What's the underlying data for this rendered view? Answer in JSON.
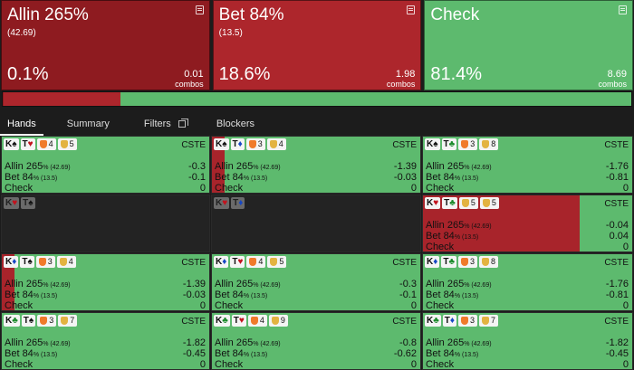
{
  "actions": [
    {
      "name": "Allin 265%",
      "sub": "(42.69)",
      "pct": "0.1%",
      "combos": "0.01",
      "combos_label": "combos",
      "color": "#8e1b20"
    },
    {
      "name": "Bet 84%",
      "sub": "(13.5)",
      "pct": "18.6%",
      "combos": "1.98",
      "combos_label": "combos",
      "color": "#ad262c"
    },
    {
      "name": "Check",
      "sub": "",
      "pct": "81.4%",
      "combos": "8.69",
      "combos_label": "combos",
      "color": "#5dba6e"
    }
  ],
  "freq_bar": [
    {
      "label": "Allin",
      "fraction": 0.001,
      "color": "#8e1b20"
    },
    {
      "label": "Bet",
      "fraction": 0.186,
      "color": "#ad262c"
    },
    {
      "label": "Check",
      "fraction": 0.814,
      "color": "#5dba6e"
    }
  ],
  "tabs": [
    {
      "label": "Hands",
      "active": true
    },
    {
      "label": "Summary",
      "active": false
    },
    {
      "label": "Filters",
      "active": false
    },
    {
      "label": "Blockers",
      "active": false
    }
  ],
  "cell_tag": "CSTE",
  "row_labels": [
    "Allin 265",
    "Bet 84",
    "Check"
  ],
  "row_subs": [
    "% (42.69)",
    "% (13.5)",
    ""
  ],
  "cells": [
    {
      "cards": [
        [
          "K",
          "s"
        ],
        [
          "T",
          "h"
        ]
      ],
      "badges": [
        [
          "orange",
          "4"
        ],
        [
          "gold",
          "5"
        ]
      ],
      "red": 0.0,
      "values": [
        "-0.3",
        "-0.1",
        "0"
      ]
    },
    {
      "cards": [
        [
          "K",
          "s"
        ],
        [
          "T",
          "d"
        ]
      ],
      "badges": [
        [
          "orange",
          "3"
        ],
        [
          "gold",
          "4"
        ]
      ],
      "red": 0.06,
      "values": [
        "-1.39",
        "-0.03",
        "0"
      ]
    },
    {
      "cards": [
        [
          "K",
          "s"
        ],
        [
          "T",
          "c"
        ]
      ],
      "badges": [
        [
          "orange",
          "3"
        ],
        [
          "gold",
          "8"
        ]
      ],
      "red": 0.0,
      "values": [
        "-1.76",
        "-0.81",
        "0"
      ]
    },
    {
      "cards": [
        [
          "K",
          "h"
        ],
        [
          "T",
          "s"
        ]
      ],
      "badges": [],
      "inactive": true
    },
    {
      "cards": [
        [
          "K",
          "h"
        ],
        [
          "T",
          "d"
        ]
      ],
      "badges": [],
      "inactive": true
    },
    {
      "cards": [
        [
          "K",
          "h"
        ],
        [
          "T",
          "c"
        ]
      ],
      "badges": [
        [
          "gold",
          "5"
        ],
        [
          "gold",
          "5"
        ]
      ],
      "red": 0.75,
      "values": [
        "-0.04",
        "0.04",
        "0"
      ]
    },
    {
      "cards": [
        [
          "K",
          "d"
        ],
        [
          "T",
          "s"
        ]
      ],
      "badges": [
        [
          "orange",
          "3"
        ],
        [
          "gold",
          "4"
        ]
      ],
      "red": 0.06,
      "values": [
        "-1.39",
        "-0.03",
        "0"
      ]
    },
    {
      "cards": [
        [
          "K",
          "d"
        ],
        [
          "T",
          "h"
        ]
      ],
      "badges": [
        [
          "orange",
          "4"
        ],
        [
          "gold",
          "5"
        ]
      ],
      "red": 0.0,
      "values": [
        "-0.3",
        "-0.1",
        "0"
      ]
    },
    {
      "cards": [
        [
          "K",
          "d"
        ],
        [
          "T",
          "c"
        ]
      ],
      "badges": [
        [
          "orange",
          "3"
        ],
        [
          "gold",
          "8"
        ]
      ],
      "red": 0.0,
      "values": [
        "-1.76",
        "-0.81",
        "0"
      ]
    },
    {
      "cards": [
        [
          "K",
          "c"
        ],
        [
          "T",
          "s"
        ]
      ],
      "badges": [
        [
          "orange",
          "3"
        ],
        [
          "gold",
          "7"
        ]
      ],
      "red": 0.0,
      "values": [
        "-1.82",
        "-0.45",
        "0"
      ]
    },
    {
      "cards": [
        [
          "K",
          "c"
        ],
        [
          "T",
          "h"
        ]
      ],
      "badges": [
        [
          "orange",
          "4"
        ],
        [
          "gold",
          "9"
        ]
      ],
      "red": 0.0,
      "values": [
        "-0.8",
        "-0.62",
        "0"
      ]
    },
    {
      "cards": [
        [
          "K",
          "c"
        ],
        [
          "T",
          "d"
        ]
      ],
      "badges": [
        [
          "orange",
          "3"
        ],
        [
          "gold",
          "7"
        ]
      ],
      "red": 0.0,
      "values": [
        "-1.82",
        "-0.45",
        "0"
      ]
    }
  ],
  "icons": {
    "note": "note-icon",
    "copy": "copy-icon",
    "badge": "shield-icon"
  }
}
